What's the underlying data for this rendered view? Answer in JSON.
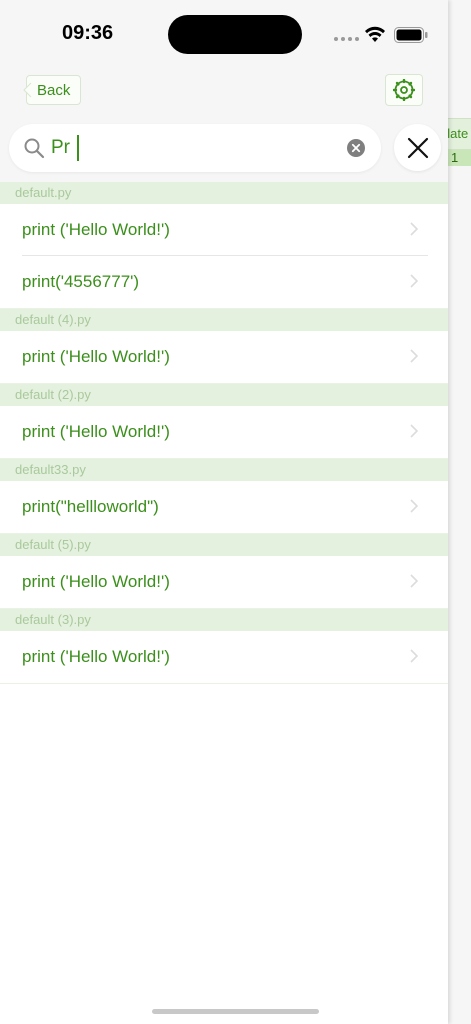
{
  "status": {
    "time": "09:36"
  },
  "nav": {
    "back_label": "Back"
  },
  "search": {
    "value": "Pr",
    "placeholder": ""
  },
  "sections": [
    {
      "file": "default.py",
      "items": [
        "print ('Hello World!')",
        "print('4556777')"
      ]
    },
    {
      "file": "default (4).py",
      "items": [
        "print ('Hello World!')"
      ]
    },
    {
      "file": "default (2).py",
      "items": [
        "print ('Hello World!')"
      ]
    },
    {
      "file": "default33.py",
      "items": [
        "print(\"hellloworld\")"
      ]
    },
    {
      "file": "default (5).py",
      "items": [
        "print ('Hello World!')"
      ]
    },
    {
      "file": "default (3).py",
      "items": [
        "print ('Hello World!')"
      ]
    }
  ],
  "background_panel": {
    "header_text": "plate",
    "cell_text": "1"
  },
  "colors": {
    "accent": "#3b8f1b",
    "section_bg": "#e4f1de",
    "section_text": "#a9c99c"
  },
  "icons": [
    "search-icon",
    "clear-icon",
    "close-icon",
    "gear-icon",
    "chevron-left-icon",
    "chevron-right-icon",
    "wifi-icon",
    "battery-icon"
  ]
}
